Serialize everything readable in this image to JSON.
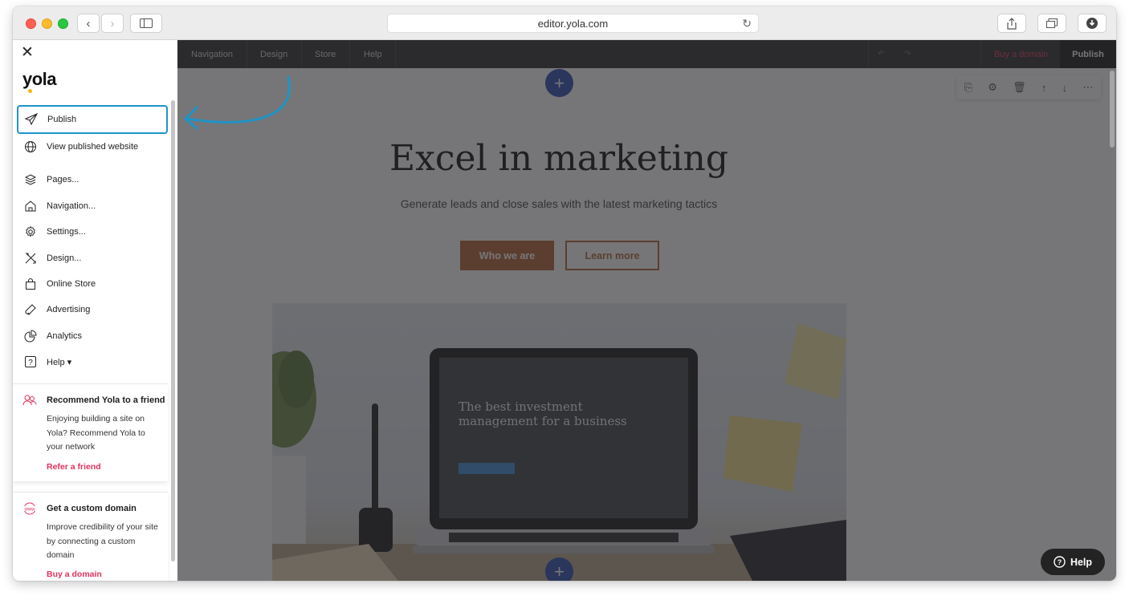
{
  "browser": {
    "url": "editor.yola.com"
  },
  "sidebar": {
    "logo": "yola",
    "items": [
      {
        "label": "Publish",
        "icon": "paper-plane-icon"
      },
      {
        "label": "View published website",
        "icon": "globe-icon"
      },
      {
        "label": "Pages...",
        "icon": "layers-icon"
      },
      {
        "label": "Navigation...",
        "icon": "home-icon"
      },
      {
        "label": "Settings...",
        "icon": "gear-icon"
      },
      {
        "label": "Design...",
        "icon": "design-tools-icon"
      },
      {
        "label": "Online Store",
        "icon": "shopping-bag-icon"
      },
      {
        "label": "Advertising",
        "icon": "megaphone-icon"
      },
      {
        "label": "Analytics",
        "icon": "pie-chart-icon"
      },
      {
        "label": "Help ▾",
        "icon": "question-icon"
      }
    ],
    "recommend": {
      "title": "Recommend Yola to a friend",
      "body": "Enjoying building a site on Yola? Recommend Yola to your network",
      "link": "Refer a friend"
    },
    "domain": {
      "title": "Get a custom domain",
      "body": "Improve credibility of your site by connecting a custom domain",
      "link": "Buy a domain",
      "icon_text": "www"
    }
  },
  "editor": {
    "nav": [
      "Navigation",
      "Design",
      "Store",
      "Help"
    ],
    "buy_domain": "Buy a domain",
    "publish": "Publish",
    "hero_title": "Excel in marketing",
    "hero_subtitle": "Generate leads and close sales with the latest marketing tactics",
    "btn_primary": "Who we are",
    "btn_secondary": "Learn more",
    "laptop_heading": "The best investment management for a business",
    "help_button": "Help"
  },
  "colors": {
    "accent_blue": "#1f94c8",
    "brand_pink": "#e0335d",
    "cta_orange": "#b46436"
  }
}
